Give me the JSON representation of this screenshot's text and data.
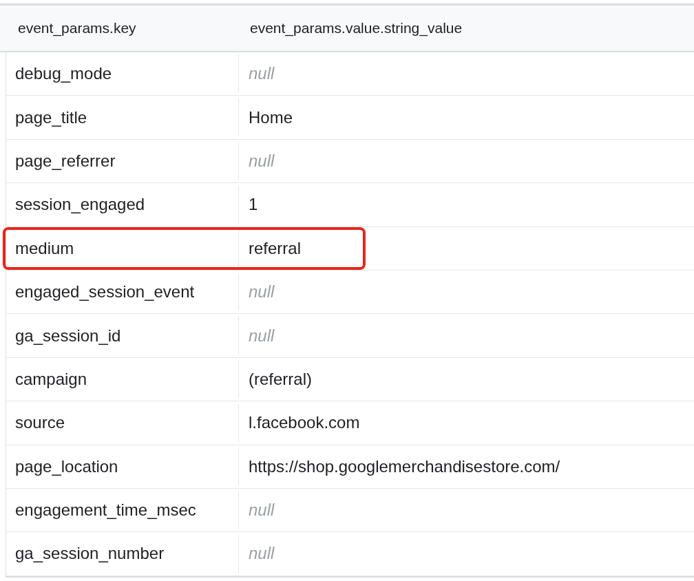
{
  "columns": [
    "event_params.key",
    "event_params.value.string_value"
  ],
  "rows": [
    {
      "key": "debug_mode",
      "value": "null",
      "kind": "null",
      "highlighted": false
    },
    {
      "key": "page_title",
      "value": "Home",
      "kind": "string",
      "highlighted": false
    },
    {
      "key": "page_referrer",
      "value": "null",
      "kind": "null",
      "highlighted": false
    },
    {
      "key": "session_engaged",
      "value": "1",
      "kind": "string",
      "highlighted": false
    },
    {
      "key": "medium",
      "value": "referral",
      "kind": "string",
      "highlighted": true
    },
    {
      "key": "engaged_session_event",
      "value": "null",
      "kind": "null",
      "highlighted": false
    },
    {
      "key": "ga_session_id",
      "value": "null",
      "kind": "null",
      "highlighted": false
    },
    {
      "key": "campaign",
      "value": "(referral)",
      "kind": "string",
      "highlighted": false
    },
    {
      "key": "source",
      "value": "l.facebook.com",
      "kind": "string",
      "highlighted": false
    },
    {
      "key": "page_location",
      "value": "https://shop.googlemerchandisestore.com/",
      "kind": "string",
      "highlighted": false
    },
    {
      "key": "engagement_time_msec",
      "value": "null",
      "kind": "null",
      "highlighted": false
    },
    {
      "key": "ga_session_number",
      "value": "null",
      "kind": "null",
      "highlighted": false
    }
  ]
}
